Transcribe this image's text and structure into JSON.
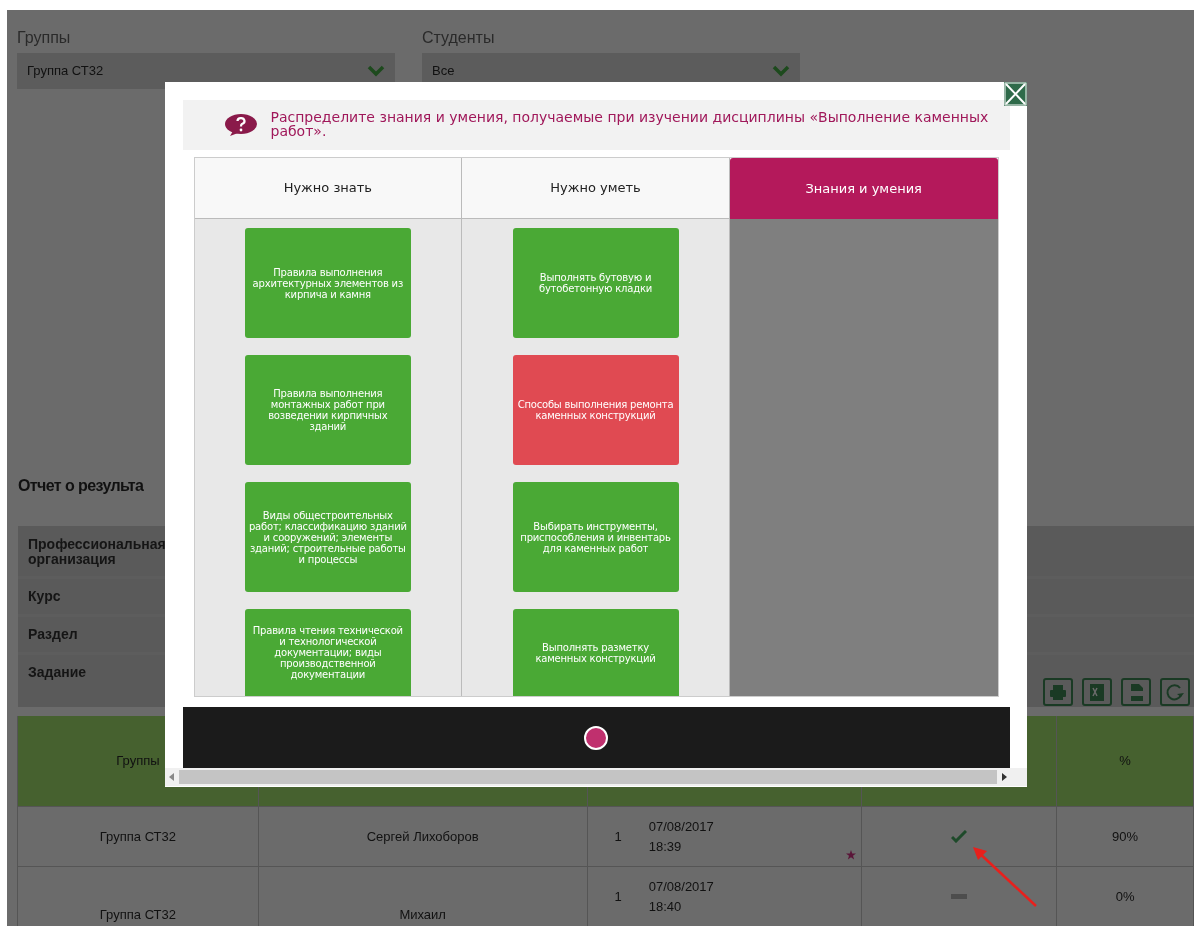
{
  "filters": [
    {
      "label": "Группы",
      "value": "Группа СТ32"
    },
    {
      "label": "Студенты",
      "value": "Все"
    }
  ],
  "report": {
    "title": "Отчет о результа",
    "fields": [
      "Профессиональная организация",
      "Курс",
      "Раздел",
      "Задание"
    ]
  },
  "toolbar": [
    {
      "kind": "print"
    },
    {
      "kind": "excel"
    },
    {
      "kind": "pdf"
    },
    {
      "kind": "refresh"
    }
  ],
  "table": {
    "columns": [
      "Группы",
      "",
      "",
      "",
      "%"
    ],
    "rows": [
      {
        "group": "Группа СТ32",
        "student": "Сергей Лихоборов",
        "attempt": "1",
        "date": "07/08/2017",
        "time": "18:39",
        "starred": true,
        "completed": true,
        "percent": "90%"
      },
      {
        "group": "Группа СТ32",
        "student": "Михаил",
        "attempt": "1",
        "date": "07/08/2017",
        "time": "18:40",
        "starred": false,
        "completed": false,
        "percent": "0%"
      }
    ]
  },
  "modal": {
    "question": "Распределите знания и умения, получаемые при изучении дисциплины «Выполнение каменных работ».",
    "columns": [
      {
        "title": "Нужно знать",
        "selected": false,
        "cards": [
          {
            "text": "Правила выполнения архитектурных элементов из кирпича и камня",
            "color": "#4aa935"
          },
          {
            "text": "Правила выполнения монтажных работ при возведении кирпичных зданий",
            "color": "#4aa935"
          },
          {
            "text": "Виды общестроительных работ; классификацию зданий и сооружений; элементы зданий; строительные работы и процессы",
            "color": "#4aa935"
          },
          {
            "text": "Правила чтения технической и технологической документации; виды производственной документации",
            "color": "#4aa935"
          }
        ]
      },
      {
        "title": "Нужно уметь",
        "selected": false,
        "cards": [
          {
            "text": "Выполнять бутовую и бутобетонную кладки",
            "color": "#4aa935"
          },
          {
            "text": "Способы выполнения ремонта каменных конструкций",
            "color": "#e04a52"
          },
          {
            "text": "Выбирать инструменты, приспособления и инвентарь для каменных работ",
            "color": "#4aa935"
          },
          {
            "text": "Выполнять разметку каменных конструкций",
            "color": "#4aa935"
          }
        ]
      },
      {
        "title": "Знания и умения",
        "selected": true
      }
    ]
  }
}
